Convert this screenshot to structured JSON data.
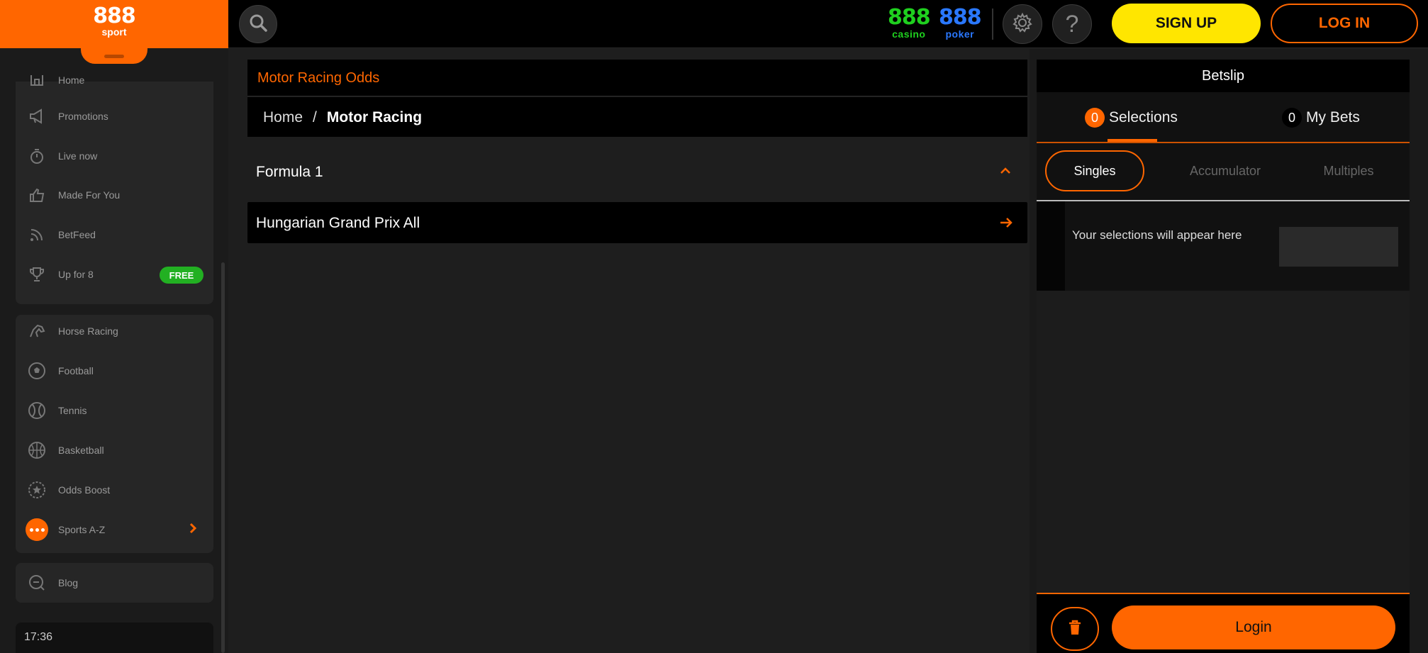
{
  "logo": {
    "brand": "888",
    "sub": "sport"
  },
  "sidebar": {
    "items": [
      {
        "label": "Home",
        "icon": "home-icon"
      },
      {
        "label": "Promotions",
        "icon": "megaphone-icon"
      },
      {
        "label": "Live now",
        "icon": "stopwatch-icon"
      },
      {
        "label": "Made For You",
        "icon": "thumbs-up-icon"
      },
      {
        "label": "BetFeed",
        "icon": "feed-icon"
      },
      {
        "label": "Up for 8",
        "icon": "trophy-icon",
        "badge": "FREE"
      }
    ],
    "sports": [
      {
        "label": "Horse Racing",
        "icon": "horse-icon"
      },
      {
        "label": "Football",
        "icon": "football-icon"
      },
      {
        "label": "Tennis",
        "icon": "tennis-icon"
      },
      {
        "label": "Basketball",
        "icon": "basketball-icon"
      },
      {
        "label": "Odds Boost",
        "icon": "odds-boost-icon"
      },
      {
        "label": "Sports A-Z",
        "icon": "more-dots-icon"
      }
    ],
    "blog": {
      "label": "Blog",
      "icon": "blog-icon"
    },
    "time": "17:36"
  },
  "topbar": {
    "casino": {
      "num": "888",
      "sub": "casino"
    },
    "poker": {
      "num": "888",
      "sub": "poker"
    },
    "help": "?",
    "signup_label": "SIGN UP",
    "login_label": "LOG IN"
  },
  "main": {
    "title": "Motor Racing Odds",
    "breadcrumb": {
      "home": "Home",
      "sep": "/",
      "current": "Motor Racing"
    },
    "section": "Formula 1",
    "event": "Hungarian Grand Prix All"
  },
  "betslip": {
    "title": "Betslip",
    "selections": {
      "count": "0",
      "label": "Selections"
    },
    "mybets": {
      "count": "0",
      "label": "My Bets"
    },
    "types": [
      "Singles",
      "Accumulator",
      "Multiples"
    ],
    "empty_text": "Your selections will appear here",
    "login_label": "Login"
  },
  "colors": {
    "accent": "#ff6600",
    "signup": "#ffe600",
    "casino": "#1fd01f",
    "poker": "#2a78ff",
    "free": "#22b022"
  }
}
